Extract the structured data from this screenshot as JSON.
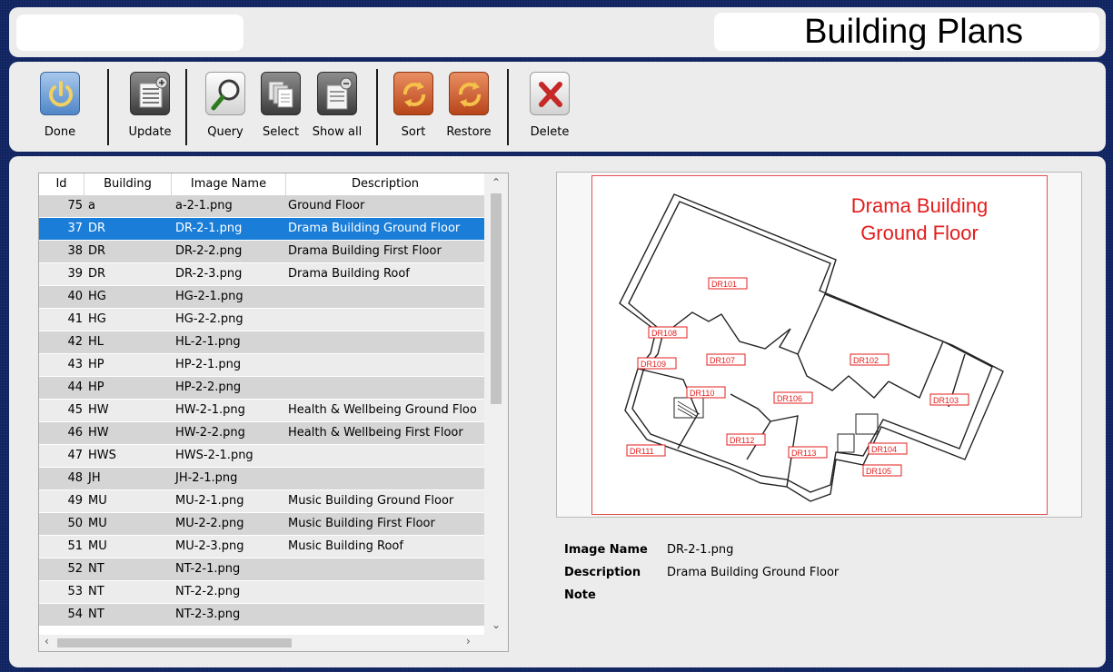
{
  "app": {
    "title": "Building Plans"
  },
  "toolbar": {
    "done": "Done",
    "update": "Update",
    "query": "Query",
    "select": "Select",
    "show_all": "Show all",
    "sort": "Sort",
    "restore": "Restore",
    "delete": "Delete"
  },
  "table": {
    "columns": [
      "Id",
      "Building",
      "Image Name",
      "Description"
    ],
    "rows": [
      {
        "id": "75",
        "building": "a",
        "image": "a-2-1.png",
        "description": "Ground Floor"
      },
      {
        "id": "37",
        "building": "DR",
        "image": "DR-2-1.png",
        "description": "Drama Building Ground Floor",
        "selected": true
      },
      {
        "id": "38",
        "building": "DR",
        "image": "DR-2-2.png",
        "description": "Drama Building First Floor"
      },
      {
        "id": "39",
        "building": "DR",
        "image": "DR-2-3.png",
        "description": "Drama Building Roof"
      },
      {
        "id": "40",
        "building": "HG",
        "image": "HG-2-1.png",
        "description": ""
      },
      {
        "id": "41",
        "building": "HG",
        "image": "HG-2-2.png",
        "description": ""
      },
      {
        "id": "42",
        "building": "HL",
        "image": "HL-2-1.png",
        "description": ""
      },
      {
        "id": "43",
        "building": "HP",
        "image": "HP-2-1.png",
        "description": ""
      },
      {
        "id": "44",
        "building": "HP",
        "image": "HP-2-2.png",
        "description": ""
      },
      {
        "id": "45",
        "building": "HW",
        "image": "HW-2-1.png",
        "description": "Health & Wellbeing Ground Floo"
      },
      {
        "id": "46",
        "building": "HW",
        "image": "HW-2-2.png",
        "description": "Health & Wellbeing First Floor"
      },
      {
        "id": "47",
        "building": "HWS",
        "image": "HWS-2-1.png",
        "description": ""
      },
      {
        "id": "48",
        "building": "JH",
        "image": "JH-2-1.png",
        "description": ""
      },
      {
        "id": "49",
        "building": "MU",
        "image": "MU-2-1.png",
        "description": "Music Building Ground Floor"
      },
      {
        "id": "50",
        "building": "MU",
        "image": "MU-2-2.png",
        "description": "Music Building First Floor"
      },
      {
        "id": "51",
        "building": "MU",
        "image": "MU-2-3.png",
        "description": "Music Building Roof"
      },
      {
        "id": "52",
        "building": "NT",
        "image": "NT-2-1.png",
        "description": ""
      },
      {
        "id": "53",
        "building": "NT",
        "image": "NT-2-2.png",
        "description": ""
      },
      {
        "id": "54",
        "building": "NT",
        "image": "NT-2-3.png",
        "description": ""
      }
    ]
  },
  "preview": {
    "plan_title_line1": "Drama Building",
    "plan_title_line2": "Ground Floor",
    "room_labels": [
      "DR101",
      "DR102",
      "DR103",
      "DR104",
      "DR105",
      "DR106",
      "DR107",
      "DR108",
      "DR109",
      "DR110",
      "DR111",
      "DR112",
      "DR113"
    ]
  },
  "details": {
    "image_name_label": "Image Name",
    "image_name_value": "DR-2-1.png",
    "description_label": "Description",
    "description_value": "Drama Building Ground Floor",
    "note_label": "Note"
  },
  "colors": {
    "background": "#10235c",
    "selection": "#1a7ed8",
    "plan_red": "#e31c1c"
  }
}
